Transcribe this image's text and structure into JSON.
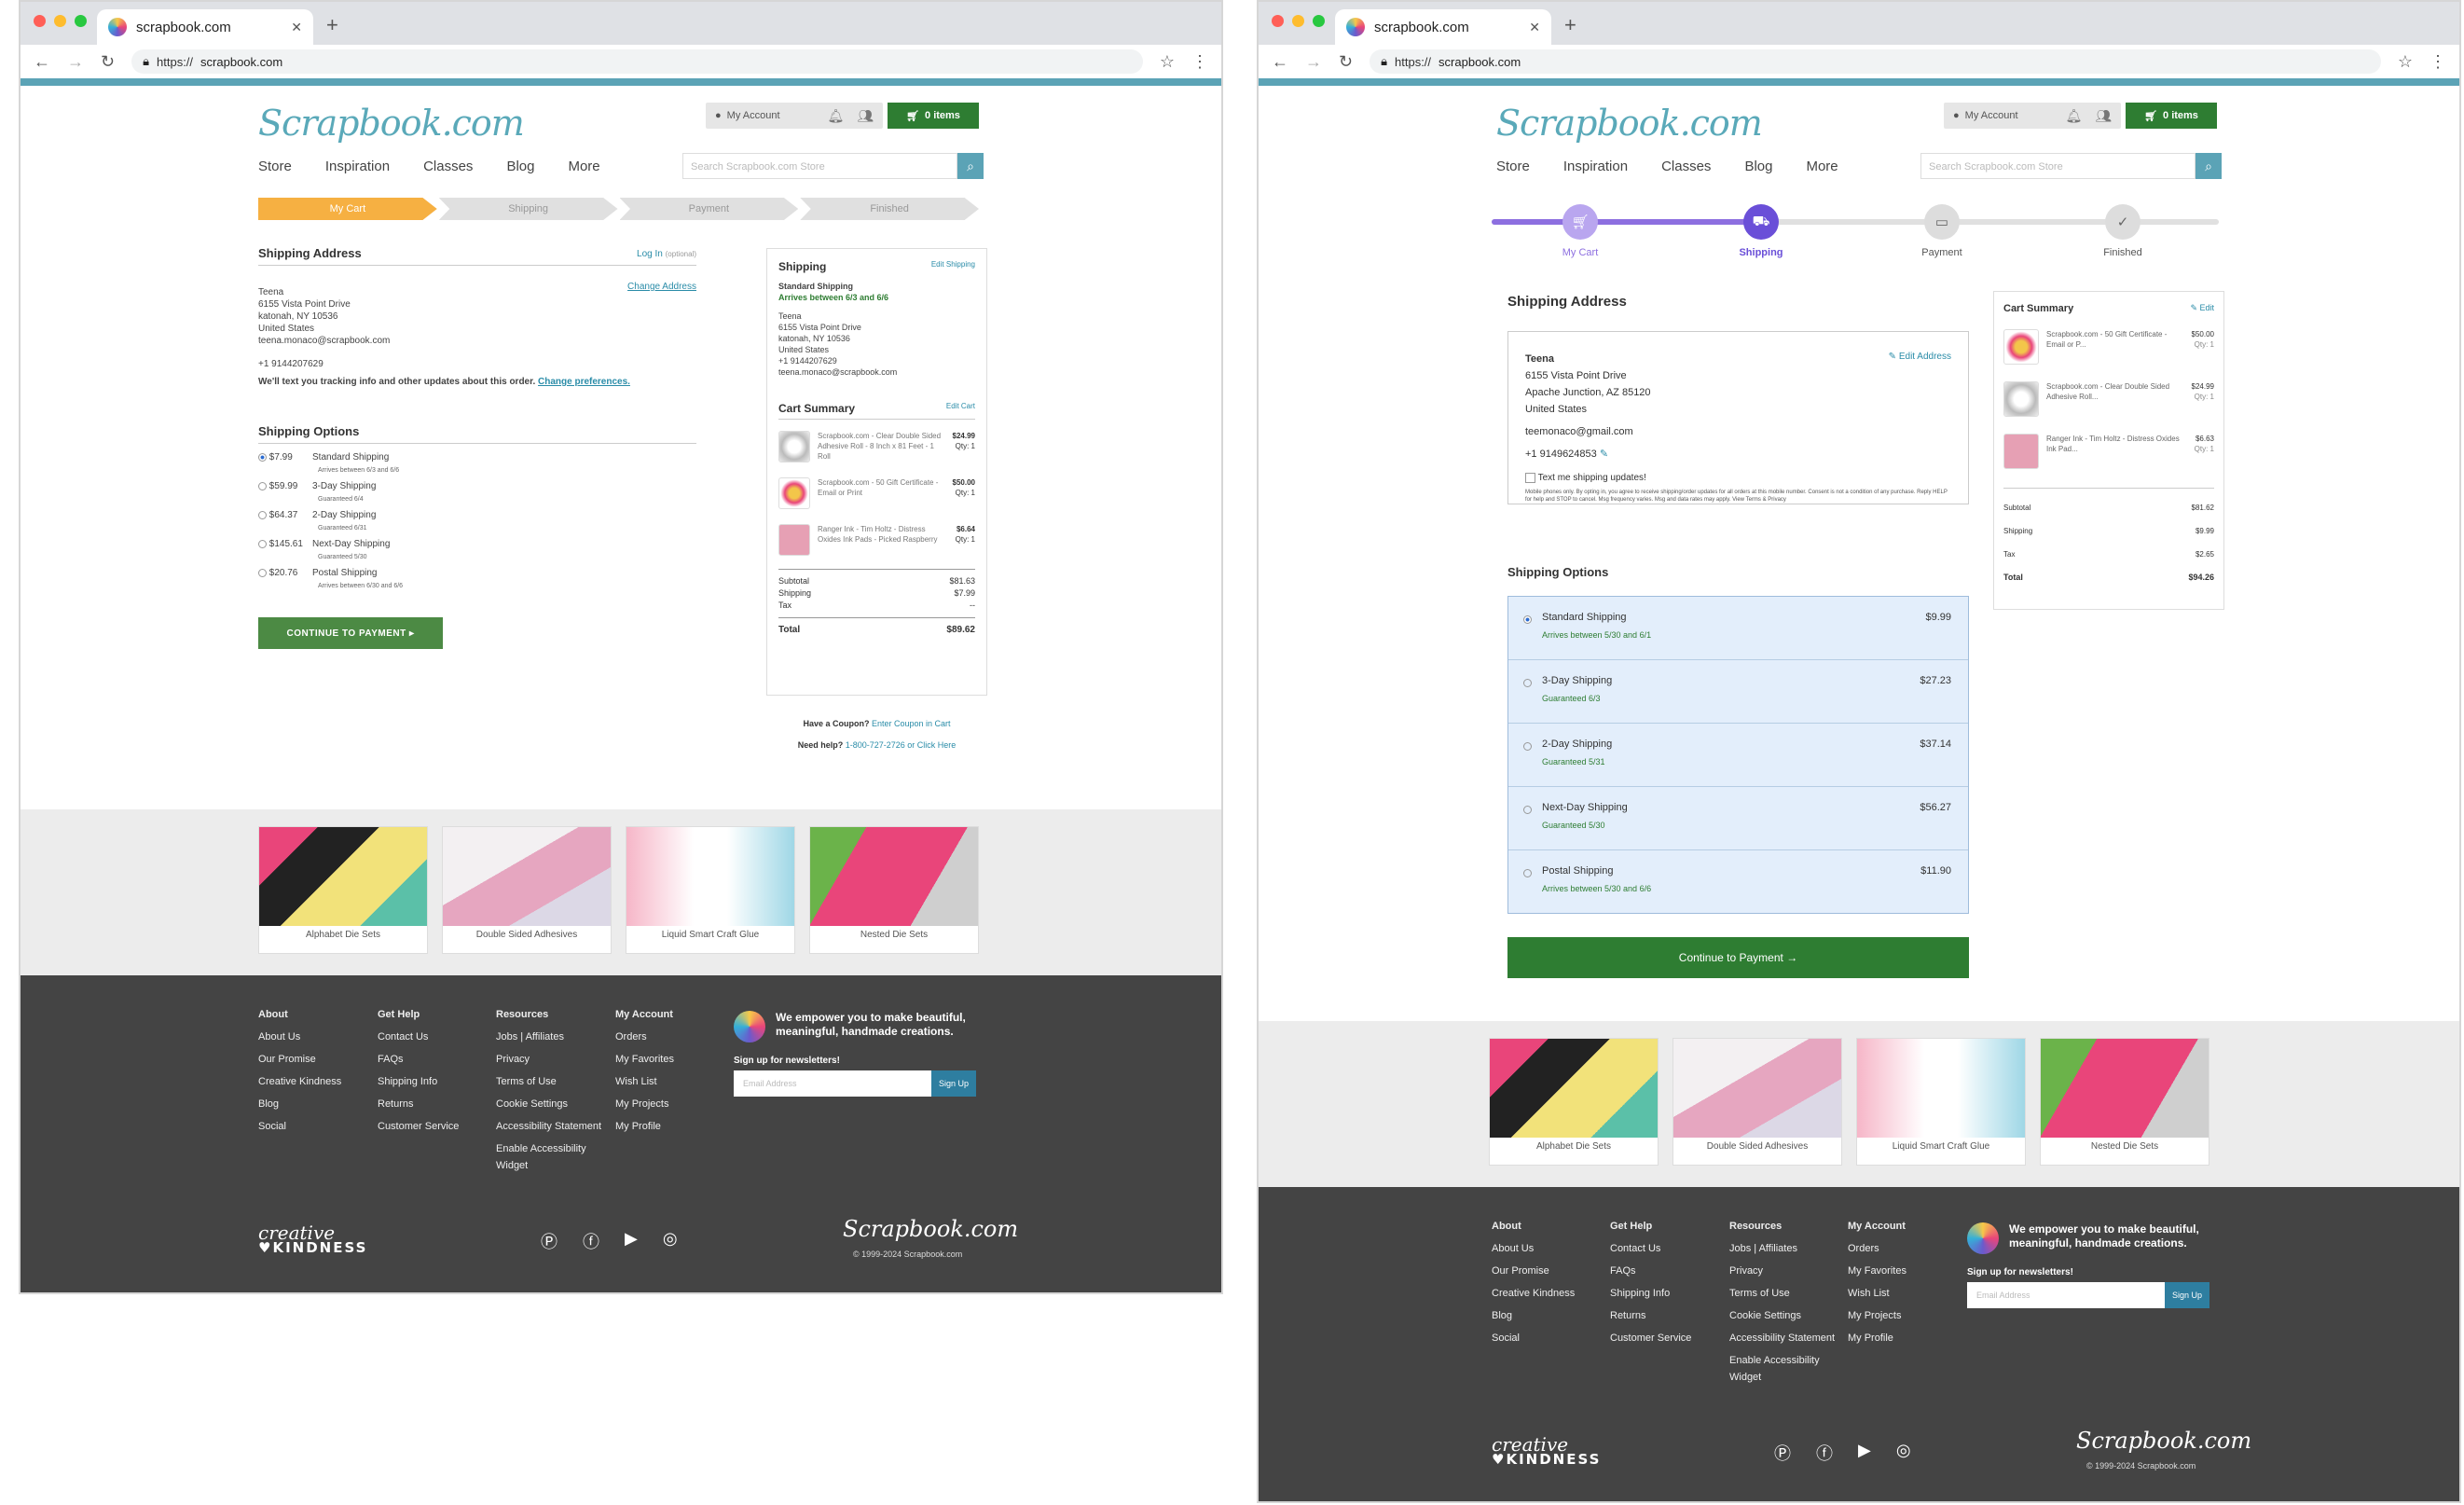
{
  "browser": {
    "tab_title": "scrapbook.com",
    "url_prefix": "https://",
    "url": "scrapbook.com"
  },
  "site": {
    "logo": "Scrapbook.com",
    "my_account": "My Account",
    "cart_items": "0 items",
    "nav": [
      "Store",
      "Inspiration",
      "Classes",
      "Blog",
      "More"
    ],
    "search_placeholder": "Search Scrapbook.com Store"
  },
  "a": {
    "steps": [
      "My Cart",
      "Shipping",
      "Payment",
      "Finished"
    ],
    "shipping_address_title": "Shipping Address",
    "log_in": "Log In",
    "optional": "(optional)",
    "change_address": "Change Address",
    "address": [
      "Teena",
      "6155 Vista Point Drive",
      "katonah, NY 10536",
      "United States",
      "teena.monaco@scrapbook.com"
    ],
    "phone": "+1 9144207629",
    "text_notice": "We'll text you tracking info and other updates about this order.",
    "change_prefs": "Change preferences.",
    "options_title": "Shipping Options",
    "options": [
      {
        "price": "$7.99",
        "name": "Standard Shipping",
        "note": "Arrives between 6/3 and 6/6"
      },
      {
        "price": "$59.99",
        "name": "3-Day Shipping",
        "note": "Guaranteed 6/4"
      },
      {
        "price": "$64.37",
        "name": "2-Day Shipping",
        "note": "Guaranteed 6/31"
      },
      {
        "price": "$145.61",
        "name": "Next-Day Shipping",
        "note": "Guaranteed 5/30"
      },
      {
        "price": "$20.76",
        "name": "Postal Shipping",
        "note": "Arrives between 6/30 and 6/6"
      }
    ],
    "continue": "CONTINUE TO PAYMENT ▸",
    "side": {
      "shipping_title": "Shipping",
      "edit_shipping": "Edit Shipping",
      "method": "Standard Shipping",
      "arrives": "Arrives between 6/3 and 6/6",
      "address": [
        "Teena",
        "6155 Vista Point Drive",
        "katonah, NY 10536",
        "United States",
        "+1 9144207629",
        "teena.monaco@scrapbook.com"
      ],
      "cart_title": "Cart Summary",
      "edit_cart": "Edit Cart",
      "items": [
        {
          "name": "Scrapbook.com - Clear Double Sided Adhesive Roll - 8 Inch x 81 Feet - 1 Roll",
          "price": "$24.99",
          "qty": "Qty: 1"
        },
        {
          "name": "Scrapbook.com - 50 Gift Certificate - Email or Print",
          "price": "$50.00",
          "qty": "Qty: 1"
        },
        {
          "name": "Ranger Ink - Tim Holtz - Distress Oxides Ink Pads - Picked Raspberry",
          "price": "$6.64",
          "qty": "Qty: 1"
        }
      ],
      "subtotal_label": "Subtotal",
      "subtotal": "$81.63",
      "shipping_label": "Shipping",
      "shipping": "$7.99",
      "tax_label": "Tax",
      "tax": "--",
      "total_label": "Total",
      "total": "$89.62"
    },
    "coupon_q": "Have a Coupon?",
    "coupon_link": "Enter Coupon in Cart",
    "help_q": "Need help?",
    "help_link": "1-800-727-2726 or Click Here"
  },
  "b": {
    "steps": [
      "My Cart",
      "Shipping",
      "Payment",
      "Finished"
    ],
    "shipping_address_title": "Shipping Address",
    "edit_address": "Edit Address",
    "address": [
      "Teena",
      "6155 Vista Point Drive",
      "Apache Junction, AZ 85120",
      "United States"
    ],
    "email": "teemonaco@gmail.com",
    "phone": "+1 9149624853",
    "text_me": "Text me shipping updates!",
    "fine_print": "Mobile phones only. By opting in, you agree to receive shipping/order updates for all orders at this mobile number. Consent is not a condition of any purchase. Reply HELP for help and STOP to cancel. Msg frequency varies. Msg and data rates may apply. View Terms & Privacy",
    "options_title": "Shipping Options",
    "options": [
      {
        "name": "Standard Shipping",
        "note": "Arrives between 5/30 and 6/1",
        "price": "$9.99"
      },
      {
        "name": "3-Day Shipping",
        "note": "Guaranteed 6/3",
        "price": "$27.23"
      },
      {
        "name": "2-Day Shipping",
        "note": "Guaranteed 5/31",
        "price": "$37.14"
      },
      {
        "name": "Next-Day Shipping",
        "note": "Guaranteed 5/30",
        "price": "$56.27"
      },
      {
        "name": "Postal Shipping",
        "note": "Arrives between 5/30 and 6/6",
        "price": "$11.90"
      }
    ],
    "continue": "Continue to Payment →",
    "cart_title": "Cart Summary",
    "edit": "Edit",
    "items": [
      {
        "name": "Scrapbook.com - 50 Gift Certificate - Email or P...",
        "price": "$50.00",
        "qty": "Qty: 1"
      },
      {
        "name": "Scrapbook.com - Clear Double Sided Adhesive Roll...",
        "price": "$24.99",
        "qty": "Qty: 1"
      },
      {
        "name": "Ranger Ink - Tim Holtz - Distress Oxides Ink Pad...",
        "price": "$6.63",
        "qty": "Qty: 1"
      }
    ],
    "subtotal_label": "Subtotal",
    "subtotal": "$81.62",
    "shipping_label": "Shipping",
    "shipping": "$9.99",
    "tax_label": "Tax",
    "tax": "$2.65",
    "total_label": "Total",
    "total": "$94.26"
  },
  "categories": [
    "Alphabet Die Sets",
    "Double Sided Adhesives",
    "Liquid Smart Craft Glue",
    "Nested Die Sets"
  ],
  "footer": {
    "cols": [
      {
        "title": "About",
        "items": [
          "About Us",
          "Our Promise",
          "Creative Kindness",
          "Blog",
          "Social"
        ]
      },
      {
        "title": "Get Help",
        "items": [
          "Contact Us",
          "FAQs",
          "Shipping Info",
          "Returns",
          "Customer Service"
        ]
      },
      {
        "title": "Resources",
        "items": [
          "Jobs | Affiliates",
          "Privacy",
          "Terms of Use",
          "Cookie Settings",
          "Accessibility Statement",
          "Enable Accessibility",
          "Widget"
        ]
      },
      {
        "title": "My Account",
        "items": [
          "Orders",
          "My Favorites",
          "Wish List",
          "My Projects",
          "My Profile"
        ]
      }
    ],
    "promo": "We empower you to make beautiful, meaningful, handmade creations.",
    "newsletter": "Sign up for newsletters!",
    "email_placeholder": "Email Address",
    "signup": "Sign Up",
    "ck_top": "creative",
    "ck_bottom": "♥KINDNESS",
    "logo": "Scrapbook.com",
    "copyright": "© 1999-2024 Scrapbook.com"
  },
  "colors": {
    "accent": "#5ba3b6",
    "green": "#2e7d32",
    "orange": "#f6b042",
    "purple": "#8d6fe0",
    "footer": "#444444"
  }
}
